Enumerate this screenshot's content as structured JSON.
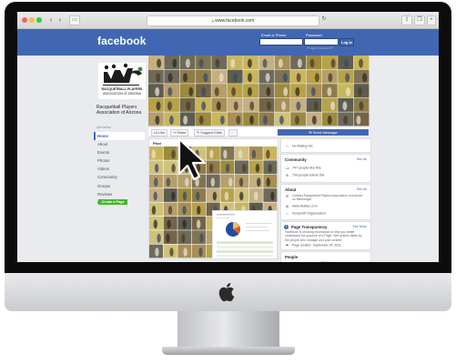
{
  "browser": {
    "url": "www.facebook.com",
    "back_icon": "back-arrow-icon",
    "forward_icon": "forward-arrow-icon"
  },
  "header": {
    "logo": "facebook",
    "email_label": "Email or Phone",
    "password_label": "Password",
    "login_button": "Log In",
    "forgot_link": "Forgot account?"
  },
  "page": {
    "name": "Racquetball Players Association of Arizona",
    "handle": "@rballaz",
    "logo_text": "RACQUETBALL PLAYERS ASSOCIATION OF ARIZONA"
  },
  "sidebar": {
    "items": [
      {
        "label": "Home"
      },
      {
        "label": "About"
      },
      {
        "label": "Events"
      },
      {
        "label": "Photos"
      },
      {
        "label": "Videos"
      },
      {
        "label": "Community"
      },
      {
        "label": "Groups"
      },
      {
        "label": "Reviews"
      },
      {
        "label": "Posts"
      }
    ],
    "create_page": "Create a Page"
  },
  "actions": {
    "like": "Like",
    "share": "Share",
    "suggest": "Suggest Edits",
    "more": "···",
    "send_message": "Send Message"
  },
  "post": {
    "label": "Phot"
  },
  "right": {
    "rating": "No Rating Yet",
    "community": {
      "title": "Community",
      "see_all": "See All",
      "likes": "747 people like this",
      "follows": "794 people follow this"
    },
    "about": {
      "title": "About",
      "see_all": "See All",
      "contact": "Contact Racquetball Players Association of Arizona on Messenger",
      "website": "www.rballaz.com",
      "category": "Nonprofit Organization"
    },
    "transparency": {
      "title": "Page Transparency",
      "see_more": "See More",
      "description": "Facebook is showing information to help you better understand the purpose of a Page. See actions taken by the people who manage and post content.",
      "created": "Page created - September 24, 2011"
    },
    "people": {
      "title": "People",
      "count": "747",
      "count_suffix": "likes"
    }
  },
  "colors": {
    "facebook_blue": "#4267b2",
    "page_background": "#e9ebee",
    "create_page_green": "#42b72a"
  }
}
